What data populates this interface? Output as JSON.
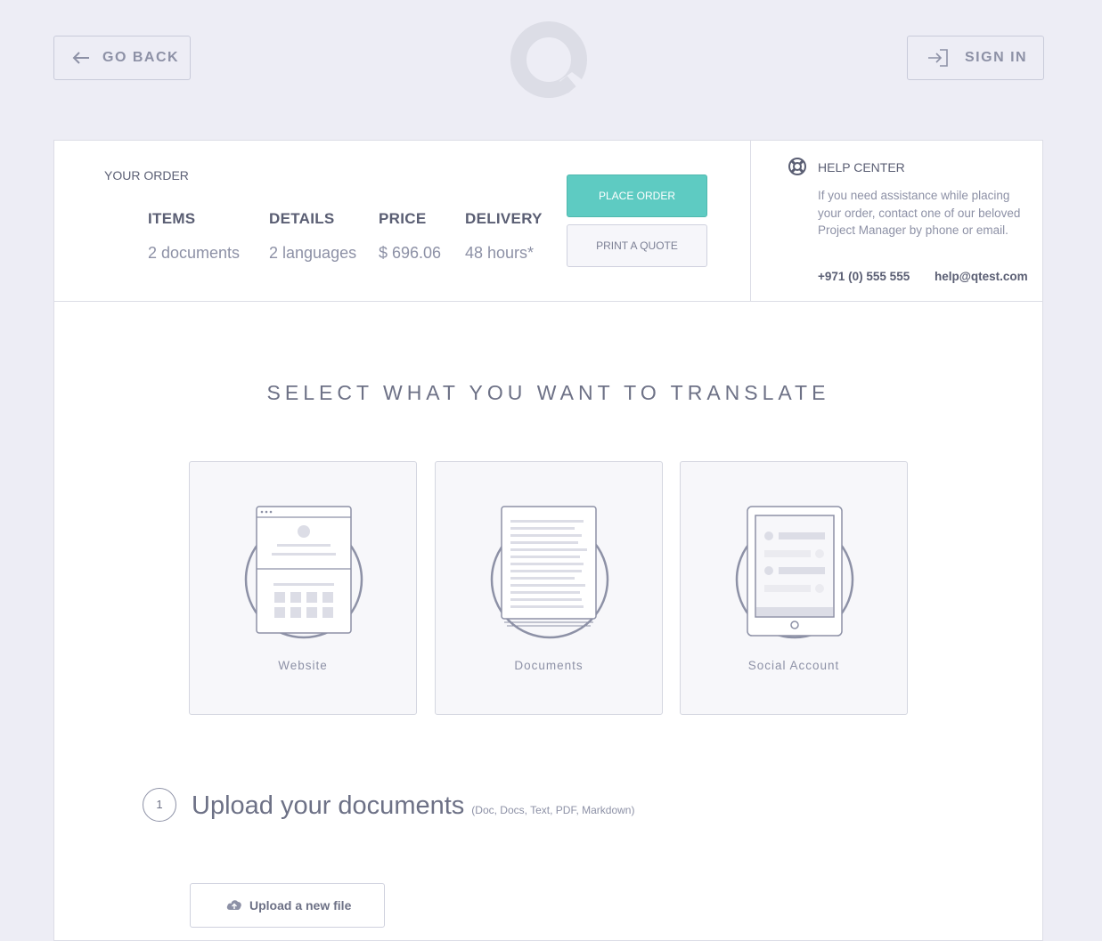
{
  "header": {
    "go_back": "GO BACK",
    "sign_in": "SIGN IN"
  },
  "order": {
    "title": "YOUR ORDER",
    "columns": [
      {
        "heading": "ITEMS",
        "value": "2 documents"
      },
      {
        "heading": "DETAILS",
        "value": "2 languages"
      },
      {
        "heading": "PRICE",
        "value": "$ 696.06"
      },
      {
        "heading": "DELIVERY",
        "value": "48 hours*"
      }
    ],
    "place_order": "PLACE ORDER",
    "print_quote": "PRINT A QUOTE"
  },
  "help": {
    "title": "HELP CENTER",
    "body": "If you need assistance while placing your order, contact one of our beloved Project Manager by phone or email.",
    "phone": "+971 (0) 555 555",
    "email": "help@qtest.com"
  },
  "select_title": "SELECT WHAT YOU WANT TO TRANSLATE",
  "choices": [
    {
      "label": "Website",
      "icon": "website-icon"
    },
    {
      "label": "Documents",
      "icon": "documents-icon"
    },
    {
      "label": "Social Account",
      "icon": "social-account-icon"
    }
  ],
  "upload_step": {
    "number": "1",
    "title": "Upload your documents",
    "formats": "(Doc, Docs, Text, PDF, Markdown)",
    "button": "Upload a new file"
  },
  "colors": {
    "accent": "#5ecbc2",
    "background": "#ededf5",
    "text": "#6d7186"
  }
}
